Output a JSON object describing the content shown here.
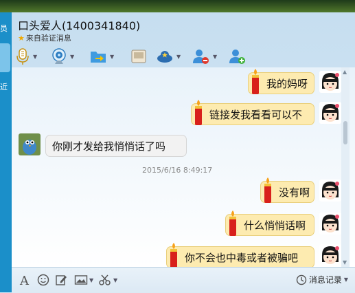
{
  "window": {
    "title": "口头爱人(1400341840)",
    "subtitle": "来自验证消息"
  },
  "left_strip": {
    "char1": "员",
    "char2": "近"
  },
  "toolbar": {
    "items": [
      "voice-icon",
      "video-icon",
      "send-file-icon",
      "remote-desktop-icon",
      "app-icon",
      "delete-friend-icon",
      "add-friend-icon"
    ]
  },
  "messages": [
    {
      "side": "right",
      "text": "我的妈呀"
    },
    {
      "side": "right",
      "text": "链接发我看看可以不"
    },
    {
      "side": "left",
      "text": "你刚才发给我悄悄话了吗"
    },
    {
      "type": "time",
      "text": "2015/6/16 8:49:17"
    },
    {
      "side": "right",
      "text": "没有啊"
    },
    {
      "side": "right",
      "text": "什么悄悄话啊"
    },
    {
      "side": "right",
      "text": "你不会也中毒或者被骗吧"
    }
  ],
  "input_toolbar": {
    "history_label": "消息记录"
  },
  "colors": {
    "accent": "#1b8fc9",
    "self_bubble": "#fdebb0",
    "other_bubble": "#f2f2f2"
  }
}
